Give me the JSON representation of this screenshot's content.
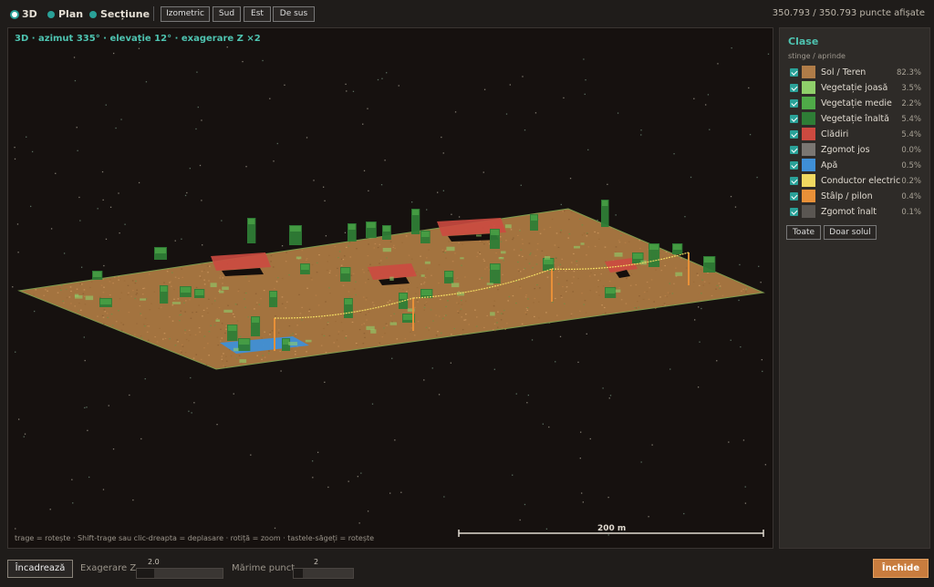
{
  "modes": [
    {
      "label": "3D",
      "active": true
    },
    {
      "label": "Plan",
      "active": false
    },
    {
      "label": "Secțiune",
      "active": false
    }
  ],
  "views": [
    "Izometric",
    "Sud",
    "Est",
    "De sus"
  ],
  "point_count": "350.793 / 350.793 puncte afișate",
  "viewport": {
    "title": "3D · azimut 335° · elevație 12° · exagerare Z ×2",
    "hint": "trage = rotește · Shift-trage sau clic-dreapta = deplasare · rotiță = zoom · tastele-săgeți = rotește",
    "scale_label": "200 m"
  },
  "panel": {
    "title": "Clase",
    "subtitle": "stinge / aprinde",
    "classes": [
      {
        "label": "Sol / Teren",
        "pct": "82.3%",
        "color": "#b07c48",
        "checked": true
      },
      {
        "label": "Vegetație joasă",
        "pct": "3.5%",
        "color": "#8fcf6a",
        "checked": true
      },
      {
        "label": "Vegetație medie",
        "pct": "2.2%",
        "color": "#4faa48",
        "checked": true
      },
      {
        "label": "Vegetație înaltă",
        "pct": "5.4%",
        "color": "#2e7d36",
        "checked": true
      },
      {
        "label": "Clădiri",
        "pct": "5.4%",
        "color": "#cc4a40",
        "checked": true
      },
      {
        "label": "Zgomot jos",
        "pct": "0.0%",
        "color": "#7a7672",
        "checked": true
      },
      {
        "label": "Apă",
        "pct": "0.5%",
        "color": "#3f8fd6",
        "checked": true
      },
      {
        "label": "Conductor electric",
        "pct": "0.2%",
        "color": "#f0d860",
        "checked": true
      },
      {
        "label": "Stâlp / pilon",
        "pct": "0.4%",
        "color": "#e89038",
        "checked": true
      },
      {
        "label": "Zgomot înalt",
        "pct": "0.1%",
        "color": "#5a5652",
        "checked": true
      }
    ],
    "btn_all": "Toate",
    "btn_ground": "Doar solul"
  },
  "bottom": {
    "fit_label": "Încadrează",
    "zexag_label": "Exagerare Z",
    "zexag_value": "2.0",
    "zexag_fraction": 0.2,
    "point_size_label": "Mărime punct",
    "point_size_value": "2",
    "point_size_fraction": 0.15,
    "close_label": "Închide"
  },
  "colors": {
    "accent": "#2aa198",
    "ground": "#b07c48",
    "close": "#c87c3e"
  }
}
